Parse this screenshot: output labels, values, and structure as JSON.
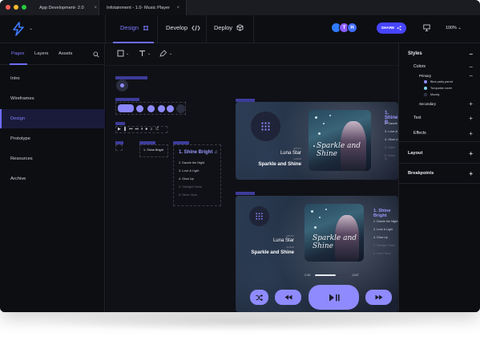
{
  "tabs": [
    {
      "label": "App Development- 2.0",
      "close": "×"
    },
    {
      "label": "Infotainment - 1.0- Music Player",
      "close": "×"
    }
  ],
  "window_dots": [
    "#ff5f57",
    "#febc2e",
    "#28c840"
  ],
  "toolbar": {
    "modes": {
      "design": "Design",
      "develop": "Develop",
      "deploy": "Deploy"
    },
    "avatars": [
      {
        "initial": "",
        "color": "#2f7bff"
      },
      {
        "initial": "T",
        "color": "#8a5cff"
      },
      {
        "initial": "H",
        "color": "#3f6bff"
      }
    ],
    "share_label": "SHARE",
    "zoom": "100%"
  },
  "sidebar": {
    "tabs": {
      "pages": "Pages",
      "layers": "Layers",
      "assets": "Assets"
    },
    "pages": [
      "Intro",
      "Wireframes",
      "Design",
      "Prototype",
      "Resources",
      "Archive"
    ],
    "active_index": 2
  },
  "canvas": {
    "tracks_small": {
      "selected": "1. Shine Bright",
      "title": "1. Shine Bright ♫",
      "list": [
        "2. Dazzle the Night",
        "3. Love & Light",
        "4. Glow Up",
        "5. Starlight Shine",
        "6. Neon Glow"
      ]
    },
    "player1": {
      "artist_label": "ARTIST",
      "artist": "Luna Star",
      "album_label": "ALBUM",
      "album": "Sparkle and Shine",
      "cover_script": "Sparkle and Shine",
      "tracks_title": "1. Shine B",
      "tracks": [
        "2. Dazzle",
        "3. Love &",
        "4. Glow U",
        "5. Starli",
        "6. Neon G"
      ]
    },
    "player2": {
      "artist_label": "ARTIST",
      "artist": "Luna Star",
      "album_label": "ALBUM",
      "album": "Sparkle and Shine",
      "cover_script": "Sparkle and Shine",
      "tracks_title": "1. Shine Bright",
      "tracks": [
        "2. Dazzle the Night",
        "3. Love & Light",
        "4. Glow Up",
        "5. Starlight Shine",
        "6. Neon Glow"
      ],
      "time_elapsed": "2:49",
      "time_remaining": "-0:57",
      "progress": 0.62
    },
    "accent": "#8f8bff"
  },
  "rpanel": {
    "styles": "Styles",
    "colors": "Colors",
    "primary": "Primary",
    "swatches": [
      {
        "label": "Blue party parrot",
        "color": "#8f8bff"
      },
      {
        "label": "Turquoise cover",
        "color": "#7fd6ea"
      },
      {
        "label": "Moody",
        "color": "#1e2238"
      }
    ],
    "secondary": "Secondary",
    "text": "Text",
    "effects": "Effects",
    "layout": "Layout",
    "breakpoints": "Breakpoints",
    "minus": "−",
    "plus": "+"
  }
}
